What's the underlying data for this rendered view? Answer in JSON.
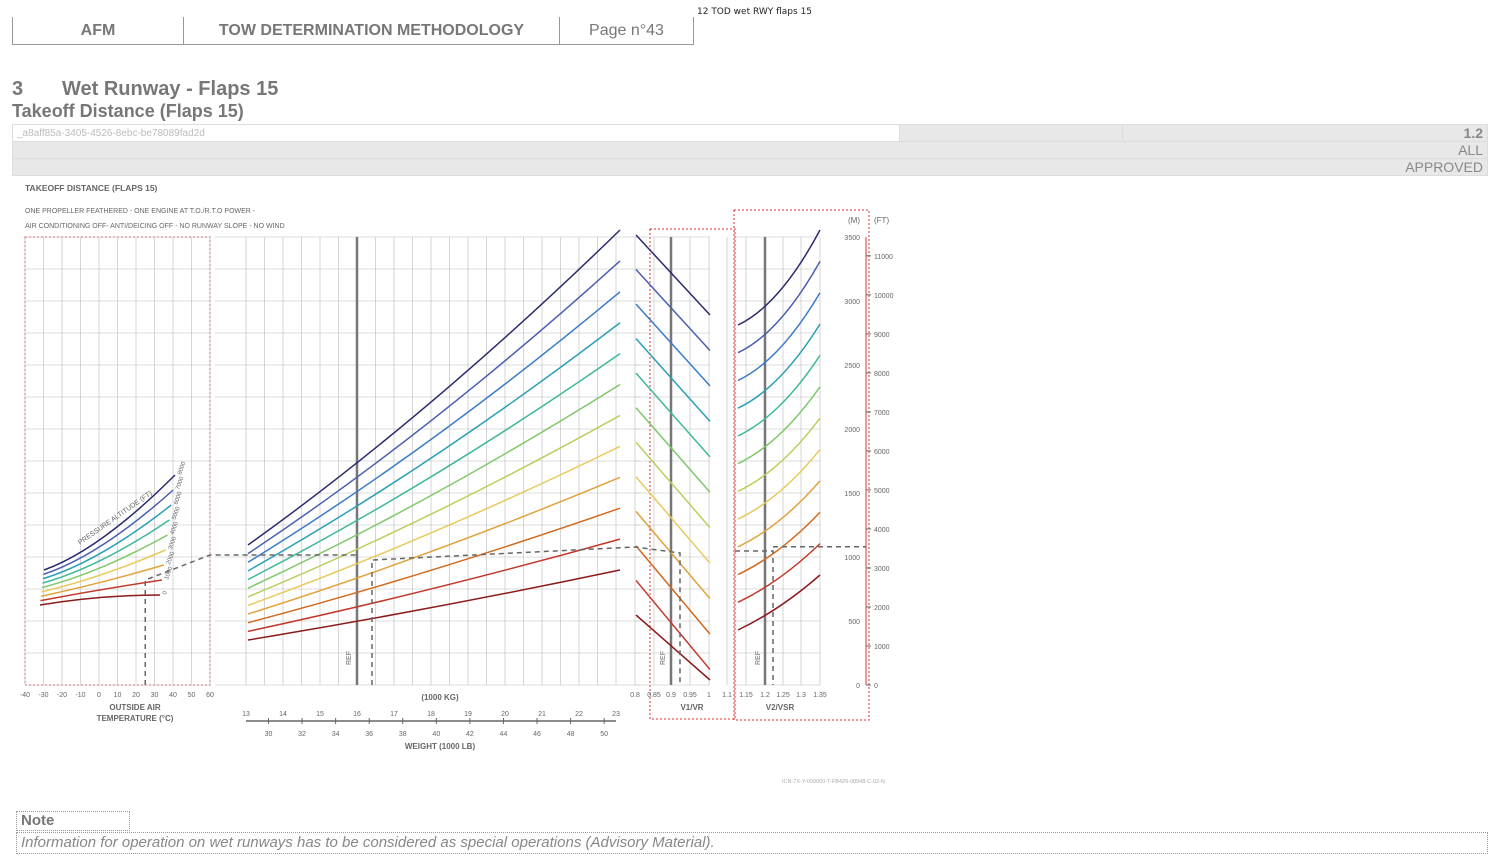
{
  "header": {
    "cells": [
      "AFM",
      "TOW DETERMINATION METHODOLOGY",
      "Page n°43"
    ],
    "doc_title": "12 TOD wet RWY flaps 15"
  },
  "section": {
    "number": "3",
    "title": "Wet Runway - Flaps 15",
    "subtitle": "Takeoff Distance (Flaps 15)"
  },
  "meta": {
    "id": "_a8aff85a-3405-4526-8ebc-be78089fad2d",
    "revision": "1.2",
    "applicability": "ALL",
    "status": "APPROVED"
  },
  "chart_data": {
    "type": "line",
    "title": "TAKEOFF DISTANCE (FLAPS 15)",
    "conditions": [
      "ONE PROPELLER FEATHERED - ONE ENGINE AT T.O./R.T.O POWER -",
      "AIR CONDITIONING OFF- ANTI/DEICING OFF - NO RUNWAY SLOPE - NO WIND"
    ],
    "oat_axis": {
      "label": [
        "OUTSIDE AIR",
        "TEMPERATURE (°C)"
      ],
      "ticks": [
        -40,
        -30,
        -20,
        -10,
        0,
        10,
        20,
        30,
        40,
        50,
        60
      ]
    },
    "pressure_altitude": {
      "label": "PRESSURE ALTITUDE (FT)",
      "curves": [
        "0",
        "1000",
        "2000",
        "3000",
        "4000",
        "5000",
        "6000",
        "7000",
        "8000"
      ]
    },
    "weight_axis": {
      "kg_label": "(1000 KG)",
      "kg_ticks": [
        13,
        14,
        15,
        16,
        17,
        18,
        19,
        20,
        21,
        22,
        23
      ],
      "lb_label": "WEIGHT (1000 LB)",
      "lb_ticks": [
        30,
        32,
        34,
        36,
        38,
        40,
        42,
        44,
        46,
        48,
        50
      ],
      "ref_kg": 16
    },
    "v1vr_axis": {
      "label": "V1/VR",
      "ticks": [
        "0.8",
        "0.85",
        "0.9",
        "0.95",
        "1",
        "1.1"
      ],
      "ref": "0.9"
    },
    "v2vsr_axis": {
      "label": "V2/VSR",
      "ticks": [
        "1.15",
        "1.2",
        "1.25",
        "1.3",
        "1.35"
      ],
      "ref": "1.2"
    },
    "ref_label": "REF",
    "distance_m": {
      "unit": "(M)",
      "ticks": [
        0,
        500,
        1000,
        1500,
        2000,
        2500,
        3000,
        3500
      ]
    },
    "distance_ft": {
      "unit": "(FT)",
      "ticks": [
        0,
        1000,
        2000,
        3000,
        4000,
        5000,
        6000,
        7000,
        8000,
        9000,
        10000,
        11000
      ]
    },
    "icn": "ICN-7X-Y-000000-T-FB429-00948-C-02-N",
    "example": {
      "oat_c": 25,
      "weight_kg": 16000,
      "v1_vr": 0.92,
      "v2_vsr": 1.22,
      "distance_m": 1080
    },
    "colors": [
      "#8b1a1a",
      "#c0392b",
      "#d2691e",
      "#e2a23b",
      "#e8c95a",
      "#b9cf5e",
      "#7ec86a",
      "#3fb89a",
      "#2a9fb5",
      "#3a7bc8",
      "#4a5fb0",
      "#2a2a6e"
    ]
  },
  "note": {
    "heading": "Note",
    "text": "Information for operation on wet runways has to be considered as special operations (Advisory Material)."
  }
}
